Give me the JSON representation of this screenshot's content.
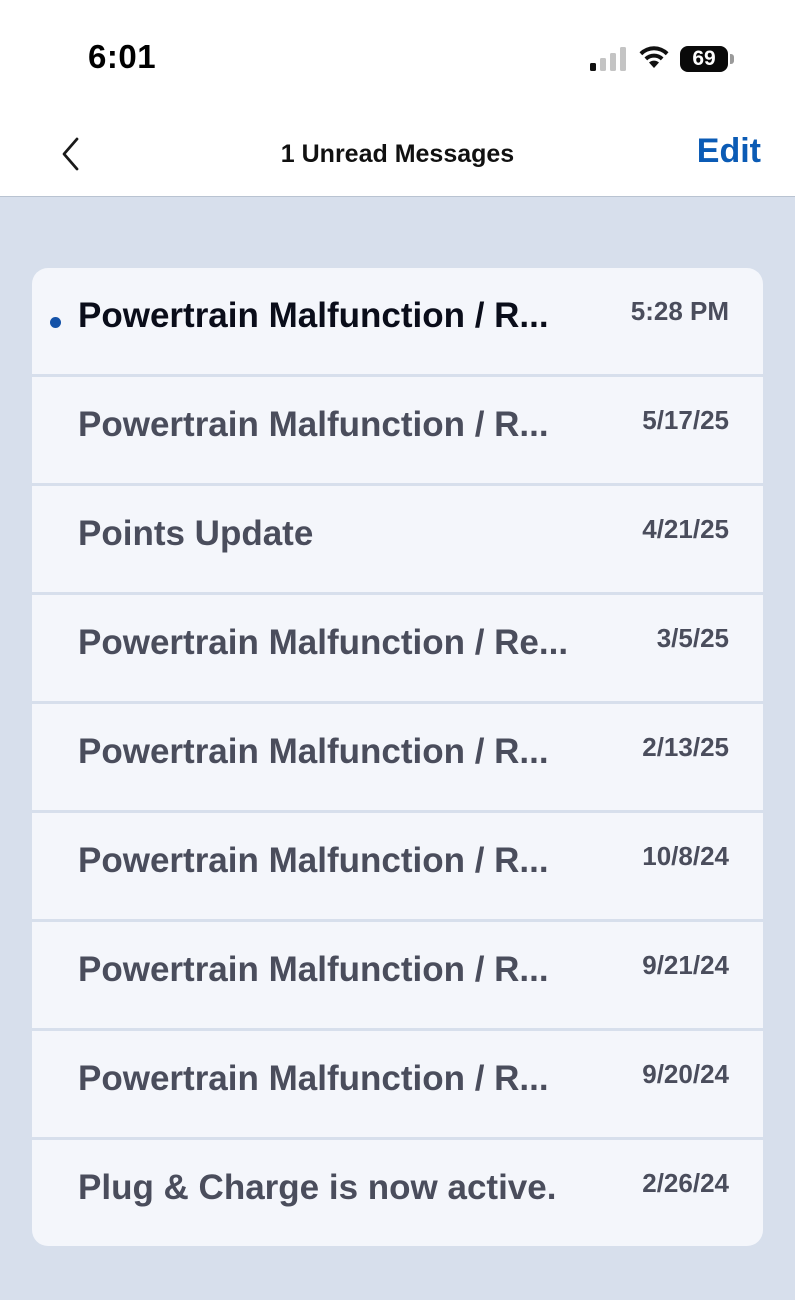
{
  "status_bar": {
    "time": "6:01",
    "battery": "69"
  },
  "nav": {
    "title": "1 Unread Messages",
    "edit_label": "Edit",
    "back_icon": "chevron-left-icon"
  },
  "messages": [
    {
      "subject": "Powertrain Malfunction / R...",
      "date": "5:28 PM",
      "unread": true
    },
    {
      "subject": "Powertrain Malfunction / R...",
      "date": "5/17/25",
      "unread": false
    },
    {
      "subject": "Points Update",
      "date": "4/21/25",
      "unread": false
    },
    {
      "subject": "Powertrain Malfunction / Re...",
      "date": "3/5/25",
      "unread": false
    },
    {
      "subject": "Powertrain Malfunction / R...",
      "date": "2/13/25",
      "unread": false
    },
    {
      "subject": "Powertrain Malfunction / R...",
      "date": "10/8/24",
      "unread": false
    },
    {
      "subject": "Powertrain Malfunction / R...",
      "date": "9/21/24",
      "unread": false
    },
    {
      "subject": "Powertrain Malfunction / R...",
      "date": "9/20/24",
      "unread": false
    },
    {
      "subject": "Plug & Charge is now active.",
      "date": "2/26/24",
      "unread": false
    }
  ],
  "colors": {
    "accent": "#0b5bb5",
    "unread_dot": "#1452a8",
    "page_background": "#d7dfec",
    "card_background": "#f4f6fb"
  }
}
